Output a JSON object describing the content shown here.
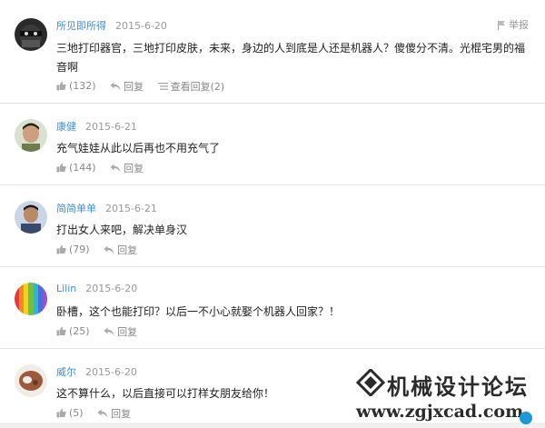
{
  "comments": [
    {
      "username": "所见即所得",
      "date": "2015-6-20",
      "text": "三地打印器官，三地打印皮肤，未来，身边的人到底是人还是机器人？傻傻分不清。光棍宅男的福音啊",
      "likes": "(132)",
      "reply_label": "回复",
      "view_replies_label": "查看回复(2)",
      "report_label": "举报"
    },
    {
      "username": "康健",
      "date": "2015-6-21",
      "text": "充气娃娃从此以后再也不用充气了",
      "likes": "(144)",
      "reply_label": "回复"
    },
    {
      "username": "简简单单",
      "date": "2015-6-21",
      "text": "打出女人来吧，解决单身汉",
      "likes": "(79)",
      "reply_label": "回复"
    },
    {
      "username": "Lilin",
      "date": "2015-6-20",
      "text": "卧槽，这个也能打印？以后一不小心就娶个机器人回家？！",
      "likes": "(25)",
      "reply_label": "回复"
    },
    {
      "username": "威尔",
      "date": "2015-6-20",
      "text": "这不算什么，以后直接可以打样女朋友给你！",
      "likes": "(5)",
      "reply_label": "回复"
    }
  ],
  "watermark": {
    "title": "机械设计论坛",
    "url": "www.zgjxcad.com"
  },
  "icons": {
    "like": "thumbs-up-icon",
    "reply": "reply-arrow-icon",
    "view_replies": "list-icon",
    "report": "flag-icon"
  },
  "colors": {
    "username": "#3f8fd0",
    "date": "#999999",
    "divider": "#e3e3e3",
    "action": "#888888"
  }
}
